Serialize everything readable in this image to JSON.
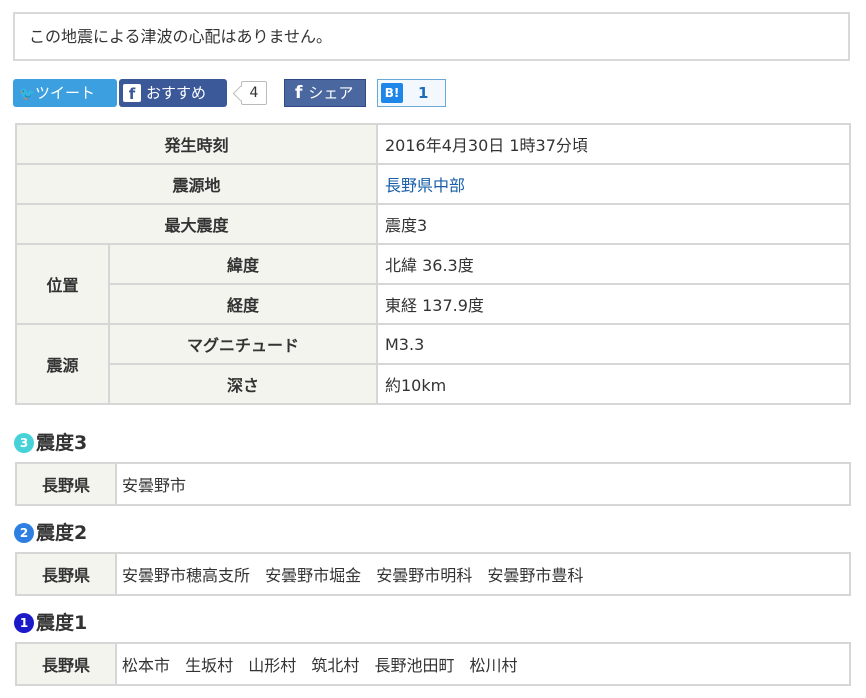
{
  "notice": "この地震による津波の心配はありません。",
  "social": {
    "tweet_label": "ツイート",
    "recommend_label": "おすすめ",
    "recommend_count": "4",
    "share_label": "シェア",
    "hatena_count": "1"
  },
  "info": {
    "time_label": "発生時刻",
    "time_value": "2016年4月30日 1時37分頃",
    "epicenter_label": "震源地",
    "epicenter_value": "長野県中部",
    "max_label": "最大震度",
    "max_value": "震度3",
    "position_label": "位置",
    "lat_label": "緯度",
    "lat_value": "北緯 36.3度",
    "lon_label": "経度",
    "lon_value": "東経 137.9度",
    "source_label": "震源",
    "mag_label": "マグニチュード",
    "mag_value": "M3.3",
    "depth_label": "深さ",
    "depth_value": "約10km"
  },
  "intensities": [
    {
      "badge": "3",
      "title": "震度3",
      "pref": "長野県",
      "cities": [
        "安曇野市"
      ]
    },
    {
      "badge": "2",
      "title": "震度2",
      "pref": "長野県",
      "cities": [
        "安曇野市穂高支所",
        "安曇野市堀金",
        "安曇野市明科",
        "安曇野市豊科"
      ]
    },
    {
      "badge": "1",
      "title": "震度1",
      "pref": "長野県",
      "cities": [
        "松本市",
        "生坂村",
        "山形村",
        "筑北村",
        "長野池田町",
        "松川村"
      ]
    }
  ],
  "colors": {
    "badge3": "#46d2d8",
    "badge2": "#2d80e2",
    "badge1": "#1a1ac8",
    "link": "#1a5fa8",
    "label_bg": "#f4f4ef"
  }
}
